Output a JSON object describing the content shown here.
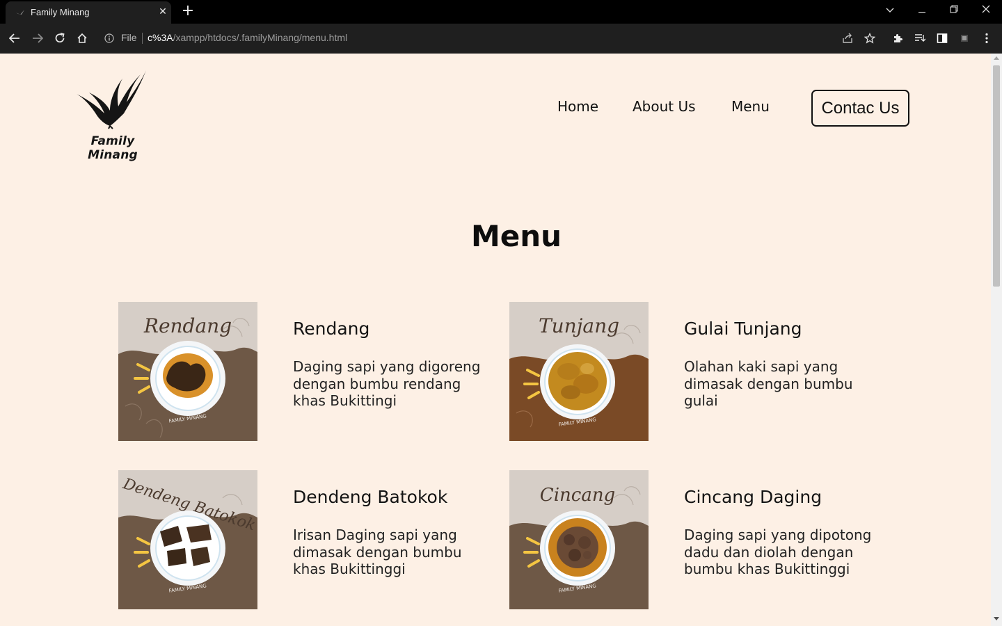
{
  "browser": {
    "tab_title": "Family Minang",
    "url_scheme_label": "File",
    "url_host": "c%3A",
    "url_path": "/xampp/htdocs/.familyMinang/menu.html"
  },
  "site": {
    "brand": "Family Minang",
    "nav": {
      "home": "Home",
      "about": "About Us",
      "menu": "Menu",
      "contact": "Contac Us"
    },
    "page_title": "Menu"
  },
  "menu_items": [
    {
      "name": "Rendang",
      "description": "Daging sapi yang digoreng dengan bumbu rendang khas Bukittingi",
      "image_script": "Rendang",
      "image_footer": "FAMILY MINANG"
    },
    {
      "name": "Gulai Tunjang",
      "description": "Olahan kaki sapi yang dimasak dengan bumbu gulai",
      "image_script": "Tunjang",
      "image_footer": "FAMILY MINANG"
    },
    {
      "name": "Dendeng Batokok",
      "description": "Irisan Daging sapi yang dimasak dengan bumbu khas Bukittinggi",
      "image_script": "Dendeng Batokok",
      "image_footer": "FAMILY MINANG"
    },
    {
      "name": "Cincang Daging",
      "description": "Daging sapi yang dipotong dadu dan diolah dengan bumbu khas Bukittinggi",
      "image_script": "Cincang",
      "image_footer": "FAMILY MINANG"
    }
  ],
  "colors": {
    "page_background": "#fdf0e5",
    "card_beige": "#d6cec7",
    "card_brown": "#6e5846",
    "card_brown_alt": "#7a4a26",
    "accent_yellow": "#f4c542"
  }
}
